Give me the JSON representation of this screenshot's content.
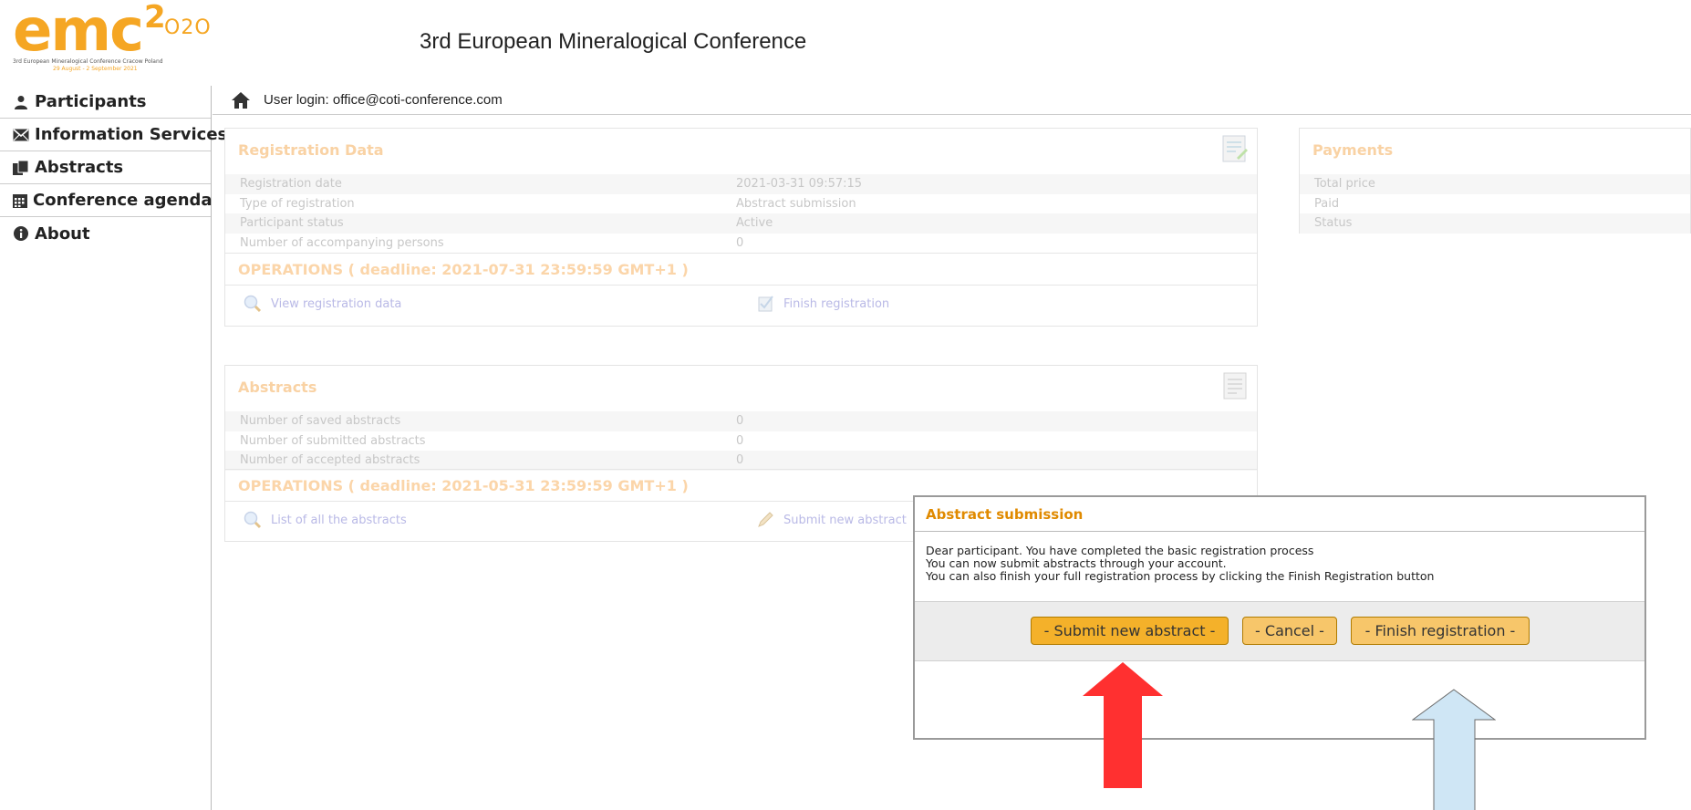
{
  "header": {
    "logo": {
      "text": "emc",
      "sup": "2",
      "year": "O2O",
      "subtitle": "3rd European Mineralogical Conference Cracow Poland",
      "dates": "29 August - 2 September 2021"
    },
    "title": "3rd European Mineralogical Conference"
  },
  "sidebar": {
    "items": [
      {
        "label": "Participants",
        "icon": "user-icon"
      },
      {
        "label": "Information Services",
        "icon": "envelope-icon"
      },
      {
        "label": "Abstracts",
        "icon": "documents-icon"
      },
      {
        "label": "Conference agenda",
        "icon": "calendar-icon"
      },
      {
        "label": "About",
        "icon": "info-icon"
      }
    ]
  },
  "userbar": {
    "login_text": "User login: office@coti-conference.com"
  },
  "registration": {
    "title": "Registration Data",
    "rows": [
      {
        "label": "Registration date",
        "value": "2021-03-31 09:57:15"
      },
      {
        "label": "Type of registration",
        "value": "Abstract submission"
      },
      {
        "label": "Participant status",
        "value": "Active"
      },
      {
        "label": "Number of accompanying persons",
        "value": "0"
      }
    ],
    "operations": "OPERATIONS ( deadline: 2021-07-31 23:59:59 GMT+1 )",
    "view_link": "View registration data",
    "finish_link": "Finish registration"
  },
  "payments": {
    "title": "Payments",
    "rows": [
      {
        "label": "Total price"
      },
      {
        "label": "Paid"
      },
      {
        "label": "Status"
      }
    ]
  },
  "abstracts": {
    "title": "Abstracts",
    "rows": [
      {
        "label": "Number of saved abstracts",
        "value": "0"
      },
      {
        "label": "Number of submitted abstracts",
        "value": "0"
      },
      {
        "label": "Number of accepted abstracts",
        "value": "0"
      }
    ],
    "operations": "OPERATIONS ( deadline: 2021-05-31 23:59:59 GMT+1 )",
    "list_link": "List of all the abstracts",
    "submit_link": "Submit new abstract"
  },
  "modal": {
    "title": "Abstract submission",
    "lines": [
      "Dear participant. You have completed the basic registration process",
      "You can now submit abstracts through your account.",
      "You can also finish your full registration process by clicking the Finish Registration button"
    ],
    "buttons": {
      "submit": "- Submit new abstract -",
      "cancel": "- Cancel -",
      "finish": "- Finish registration -"
    }
  },
  "colors": {
    "brand": "#f5a623",
    "modal_title": "#e08a00",
    "arrow_red": "#ff3030",
    "arrow_blue": "#cfe6f5"
  }
}
